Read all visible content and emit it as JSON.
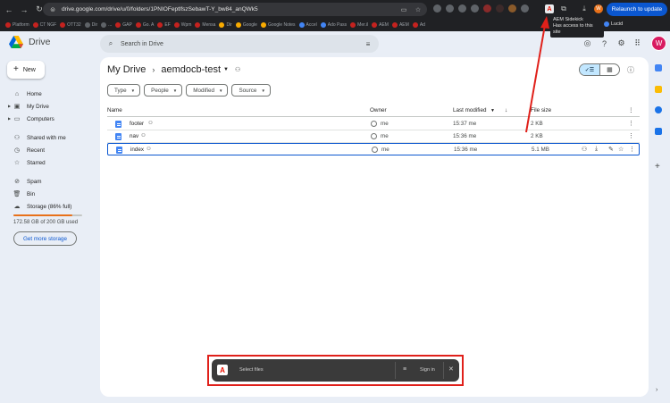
{
  "browser": {
    "url": "drive.google.com/drive/u/0/folders/1PNIOFeptlfszSebawT-Y_bw84_anQWk5",
    "relaunch_label": "Relaunch to update",
    "profile_initial": "W",
    "tooltip_title": "AEM Sidekick",
    "tooltip_sub": "Has access to this site",
    "bookmark_lucid": "Lucid",
    "bookmarks": [
      "Platform",
      "CT NGF",
      "OTT32",
      "Dir",
      "...",
      "GAP",
      "Go. A",
      "EF",
      "Wpm",
      "Mensa",
      "Dir",
      "Google",
      "Google Notes",
      "Accel",
      "Ado Pass",
      "Mer.il",
      "AEM",
      "AEM",
      "Ad"
    ]
  },
  "drive": {
    "app_name": "Drive",
    "search_placeholder": "Search in Drive",
    "avatar_initial": "W",
    "new_label": "New",
    "nav": [
      {
        "label": "Home",
        "icon": "home-icon"
      },
      {
        "label": "My Drive",
        "icon": "my-drive-icon"
      },
      {
        "label": "Computers",
        "icon": "computers-icon"
      },
      {
        "label": "Shared with me",
        "icon": "shared-icon"
      },
      {
        "label": "Recent",
        "icon": "clock-icon"
      },
      {
        "label": "Starred",
        "icon": "star-icon"
      },
      {
        "label": "Spam",
        "icon": "spam-icon"
      },
      {
        "label": "Bin",
        "icon": "bin-icon"
      },
      {
        "label": "Storage (86% full)",
        "icon": "cloud-icon"
      }
    ],
    "storage_used_fraction": 0.86,
    "storage_text": "172.58 GB of 200 GB used",
    "get_storage_label": "Get more storage",
    "breadcrumb": {
      "root": "My Drive",
      "folder": "aemdocb-test"
    },
    "filters": [
      "Type",
      "People",
      "Modified",
      "Source"
    ],
    "columns": {
      "name": "Name",
      "owner": "Owner",
      "modified": "Last modified",
      "size": "File size"
    },
    "files": [
      {
        "name": "footer",
        "owner": "me",
        "modified": "15:37 me",
        "size": "2 KB"
      },
      {
        "name": "nav",
        "owner": "me",
        "modified": "15:36 me",
        "size": "2 KB"
      },
      {
        "name": "index",
        "owner": "me",
        "modified": "15:36 me",
        "size": "5.1 MB"
      }
    ]
  },
  "sidekick": {
    "select_label": "Select files",
    "sign_in_label": "Sign in"
  },
  "colors": {
    "accent": "#0b57d0",
    "annotation_red": "#e0201a",
    "storage_orange": "#e8711a"
  }
}
